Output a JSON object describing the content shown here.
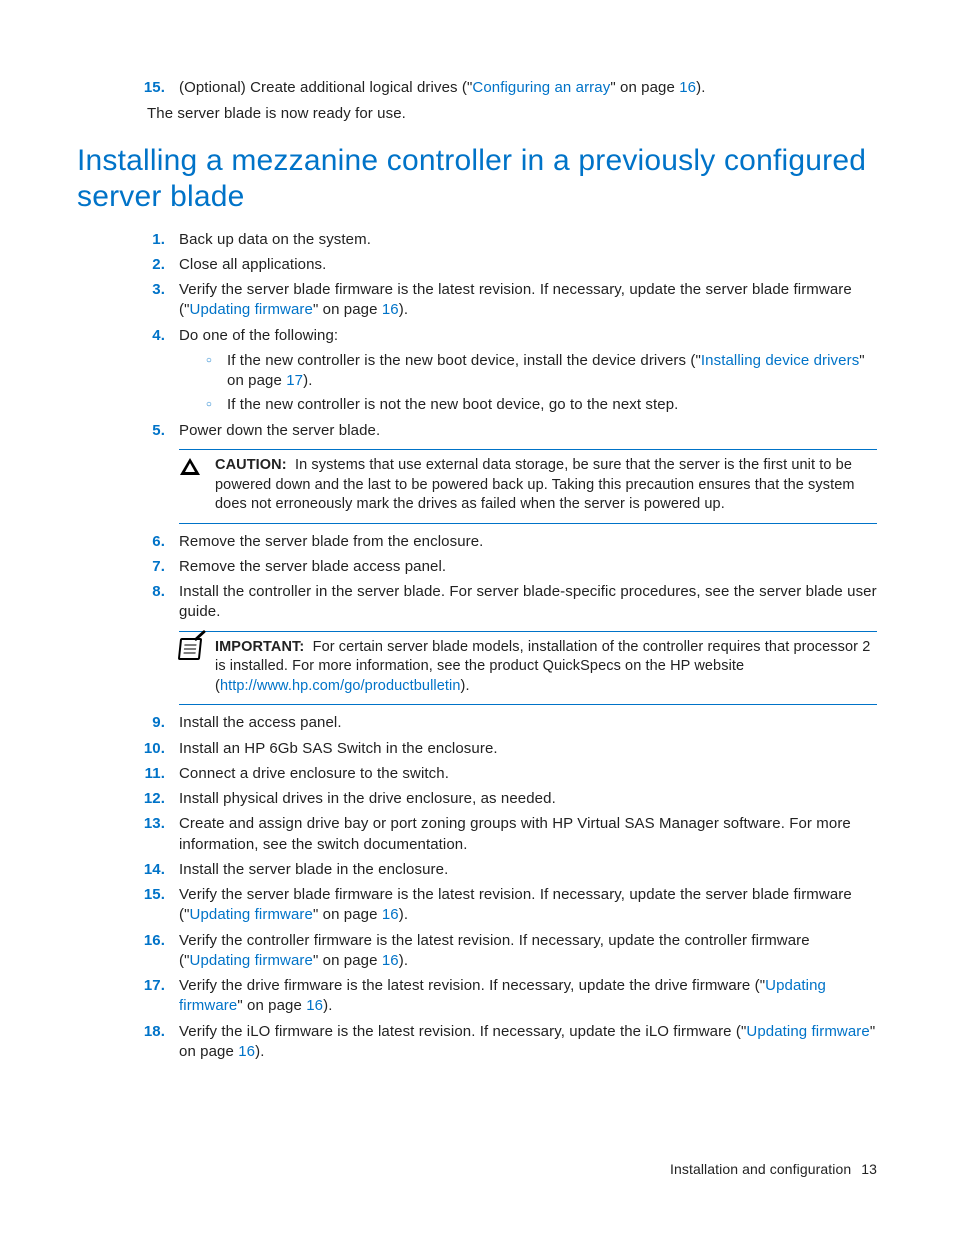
{
  "intro": {
    "num": "15.",
    "pre": "(Optional) Create additional logical drives (\"",
    "link": "Configuring an array",
    "mid": "\" on page ",
    "page": "16",
    "post": ")."
  },
  "ready": "The server blade is now ready for use.",
  "heading": "Installing a mezzanine controller in a previously configured server blade",
  "steps": {
    "s1": {
      "n": "1.",
      "t": "Back up data on the system."
    },
    "s2": {
      "n": "2.",
      "t": "Close all applications."
    },
    "s3": {
      "n": "3.",
      "pre": "Verify the server blade firmware is the latest revision. If necessary, update the server blade firmware (\"",
      "link": "Updating firmware",
      "mid": "\" on page ",
      "page": "16",
      "post": ")."
    },
    "s4": {
      "n": "4.",
      "t": "Do one of the following:"
    },
    "s4a": {
      "pre": "If the new controller is the new boot device, install the device drivers (\"",
      "link": "Installing device drivers",
      "mid": "\" on page ",
      "page": "17",
      "post": ")."
    },
    "s4b": {
      "t": "If the new controller is not the new boot device, go to the next step."
    },
    "s5": {
      "n": "5.",
      "t": "Power down the server blade."
    },
    "caution": {
      "lead": "CAUTION:",
      "body": "In systems that use external data storage, be sure that the server is the first unit to be powered down and the last to be powered back up. Taking this precaution ensures that the system does not erroneously mark the drives as failed when the server is powered up."
    },
    "s6": {
      "n": "6.",
      "t": "Remove the server blade from the enclosure."
    },
    "s7": {
      "n": "7.",
      "t": "Remove the server blade access panel."
    },
    "s8": {
      "n": "8.",
      "t": "Install the controller in the server blade. For server blade-specific procedures, see the server blade user guide."
    },
    "important": {
      "lead": "IMPORTANT:",
      "pre": "For certain server blade models, installation of the controller requires that processor 2 is installed. For more information, see the product QuickSpecs on the HP website (",
      "url": "http://www.hp.com/go/productbulletin",
      "post": ")."
    },
    "s9": {
      "n": "9.",
      "t": "Install the access panel."
    },
    "s10": {
      "n": "10.",
      "t": "Install an HP 6Gb SAS Switch in the enclosure."
    },
    "s11": {
      "n": "11.",
      "t": "Connect a drive enclosure to the switch."
    },
    "s12": {
      "n": "12.",
      "t": "Install physical drives in the drive enclosure, as needed."
    },
    "s13": {
      "n": "13.",
      "t": "Create and assign drive bay or port zoning groups with HP Virtual SAS Manager software. For more information, see the switch documentation."
    },
    "s14": {
      "n": "14.",
      "t": "Install the server blade in the enclosure."
    },
    "s15": {
      "n": "15.",
      "pre": "Verify the server blade firmware is the latest revision. If necessary, update the server blade firmware (\"",
      "link": "Updating firmware",
      "mid": "\" on page ",
      "page": "16",
      "post": ")."
    },
    "s16": {
      "n": "16.",
      "pre": "Verify the controller firmware is the latest revision. If necessary, update the controller firmware (\"",
      "link": "Updating firmware",
      "mid": "\" on page ",
      "page": "16",
      "post": ")."
    },
    "s17": {
      "n": "17.",
      "pre": "Verify the drive firmware is the latest revision. If necessary, update the drive firmware (\"",
      "link": "Updating firmware",
      "mid": "\" on page ",
      "page": "16",
      "post": ")."
    },
    "s18": {
      "n": "18.",
      "pre": "Verify the iLO firmware is the latest revision. If necessary, update the iLO firmware (\"",
      "link": "Updating firmware",
      "mid": "\" on page ",
      "page": "16",
      "post": ")."
    }
  },
  "footer": {
    "section": "Installation and configuration",
    "page": "13"
  }
}
